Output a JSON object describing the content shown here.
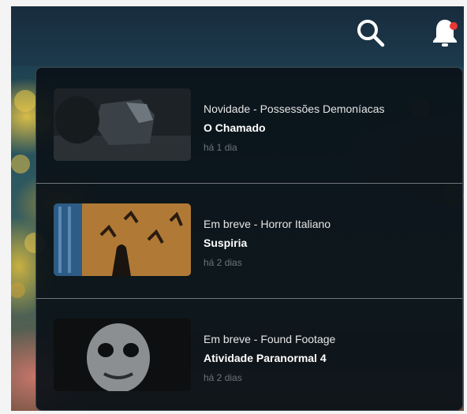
{
  "notifications": [
    {
      "subtitle": "Novidade - Possessões Demoníacas",
      "title": "O Chamado",
      "time": "há 1 dia"
    },
    {
      "subtitle": "Em breve - Horror Italiano",
      "title": "Suspiria",
      "time": "há 2 dias"
    },
    {
      "subtitle": "Em breve - Found Footage",
      "title": "Atividade Paranormal 4",
      "time": "há 2 dias"
    }
  ],
  "icons": {
    "search": "search-icon",
    "bell": "bell-icon"
  },
  "colors": {
    "panel_bg": "#0a1118",
    "badge": "#e53935",
    "divider": "#6f767c",
    "time_text": "#6d747a"
  }
}
